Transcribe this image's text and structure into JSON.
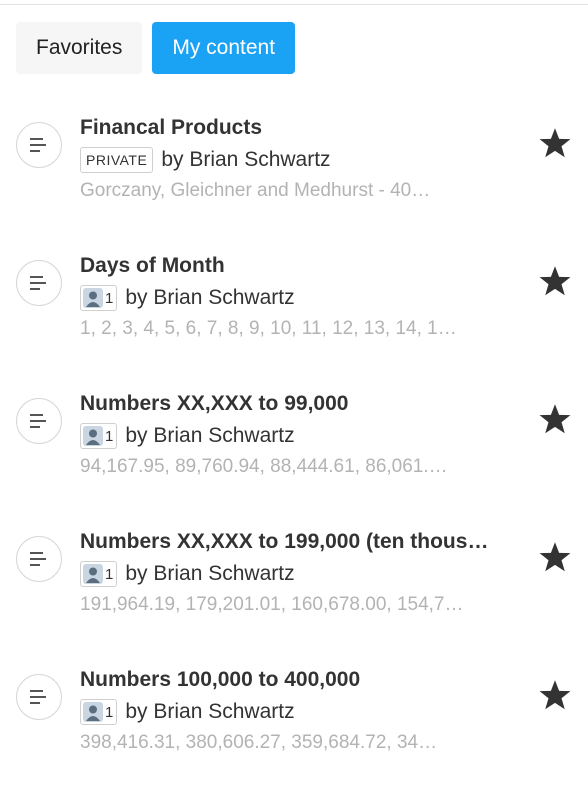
{
  "tabs": [
    {
      "label": "Favorites",
      "active": false
    },
    {
      "label": "My content",
      "active": true
    }
  ],
  "accent_color": "#1aa3f4",
  "items": [
    {
      "title": "Financal Products",
      "badge_type": "private",
      "badge_label": "PRIVATE",
      "share_count": "",
      "byline": "by Brian Schwartz",
      "preview": "Gorczany, Gleichner and Medhurst - 40…",
      "starred": true
    },
    {
      "title": "Days of Month",
      "badge_type": "shared",
      "badge_label": "",
      "share_count": "1",
      "byline": "by Brian Schwartz",
      "preview": "1, 2, 3, 4, 5, 6, 7, 8, 9, 10, 11, 12, 13, 14, 1…",
      "starred": true
    },
    {
      "title": "Numbers XX,XXX to 99,000",
      "badge_type": "shared",
      "badge_label": "",
      "share_count": "1",
      "byline": "by Brian Schwartz",
      "preview": "94,167.95, 89,760.94, 88,444.61, 86,061.…",
      "starred": true
    },
    {
      "title": "Numbers XX,XXX to 199,000 (ten thous…",
      "badge_type": "shared",
      "badge_label": "",
      "share_count": "1",
      "byline": "by Brian Schwartz",
      "preview": "191,964.19, 179,201.01, 160,678.00, 154,7…",
      "starred": true
    },
    {
      "title": "Numbers 100,000 to 400,000",
      "badge_type": "shared",
      "badge_label": "",
      "share_count": "1",
      "byline": "by Brian Schwartz",
      "preview": "398,416.31, 380,606.27, 359,684.72, 34…",
      "starred": true
    }
  ]
}
